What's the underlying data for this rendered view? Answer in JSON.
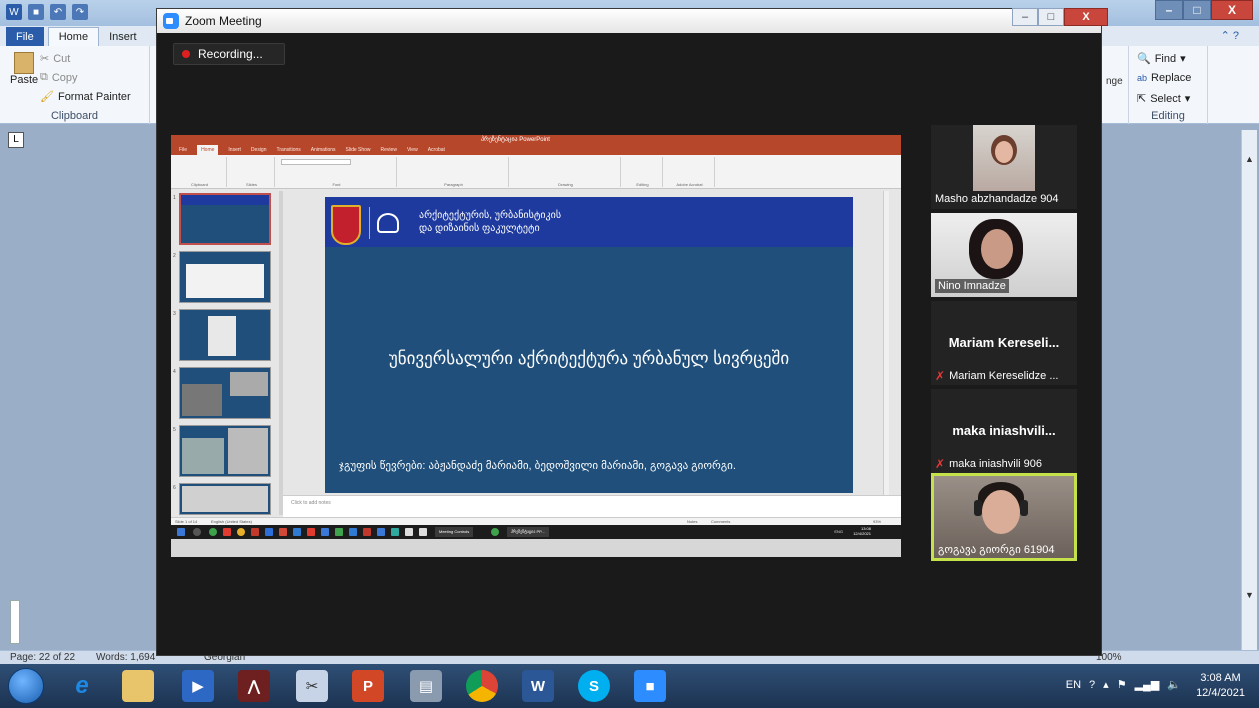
{
  "word": {
    "tabs": [
      "File",
      "Home",
      "Insert"
    ],
    "ribbon": {
      "clipboard": {
        "paste": "Paste",
        "cut": "Cut",
        "copy": "Copy",
        "format_painter": "Format Painter",
        "label": "Clipboard"
      },
      "editing": {
        "find": "Find",
        "replace": "Replace",
        "select": "Select",
        "label": "Editing"
      },
      "partial_text": "nge"
    },
    "status": {
      "page": "Page: 22 of 22",
      "words": "Words: 1,694",
      "language": "Georgian",
      "zoom": "100%"
    }
  },
  "zoom": {
    "title": "Zoom Meeting",
    "recording": "Recording...",
    "participants": [
      {
        "name": "Masho abzhandadze 904",
        "video": true,
        "muted": false
      },
      {
        "name": "Nino Imnadze",
        "video": true,
        "muted": false
      },
      {
        "name": "Mariam Kereseli...",
        "label": "Mariam Kereselidze ...",
        "video": false,
        "muted": true
      },
      {
        "name": "maka iniashvili...",
        "label": "maka iniashvili 906",
        "video": false,
        "muted": true
      },
      {
        "name": "გოგავა გიორგი 61904",
        "video": true,
        "muted": false,
        "active_speaker": true
      }
    ]
  },
  "share": {
    "ppt_title": "პრეზენტაცია PowerPoint",
    "ppt_tabs": [
      "File",
      "Home",
      "Insert",
      "Design",
      "Transitions",
      "Animations",
      "Slide Show",
      "Review",
      "View",
      "Acrobat"
    ],
    "ribbon_groups": [
      "Clipboard",
      "Slides",
      "Font",
      "Paragraph",
      "Drawing",
      "Editing",
      "Adobe Acrobat"
    ],
    "slide": {
      "org_line1": "არქიტექტურის, ურბანისტიკის",
      "org_line2": "და დიზაინის ფაკულტეტი",
      "title": "უნივერსალური აქრიტექტურა ურბანულ სივრცეში",
      "subtitle": "ჯგუფის წევრები: აბჟანდაძე მარიამი, ბედოშვილი მარიამი, გოგავა გიორგი."
    },
    "notes_placeholder": "Click to add notes",
    "status_left": "Slide 1 of 14",
    "status_lang": "English (United States)",
    "status_notes": "Notes",
    "status_comments": "Comments",
    "status_zoom": "93%",
    "taskbar": {
      "meeting_controls": "Meeting Controls",
      "ppt_task": "პრეზენტაცია PP...",
      "clock_time": "13:08",
      "clock_date": "12/4/2021",
      "tray_lang": "ENG"
    }
  },
  "taskbar": {
    "lang": "EN",
    "time": "3:08 AM",
    "date": "12/4/2021"
  },
  "colors": {
    "ppt_accent": "#b7472a",
    "slide_bg": "#1f4f7a",
    "slide_band": "#1e3a9e",
    "active_speaker": "#c6e24a",
    "muted": "#e63838",
    "recording_dot": "#e02020"
  }
}
